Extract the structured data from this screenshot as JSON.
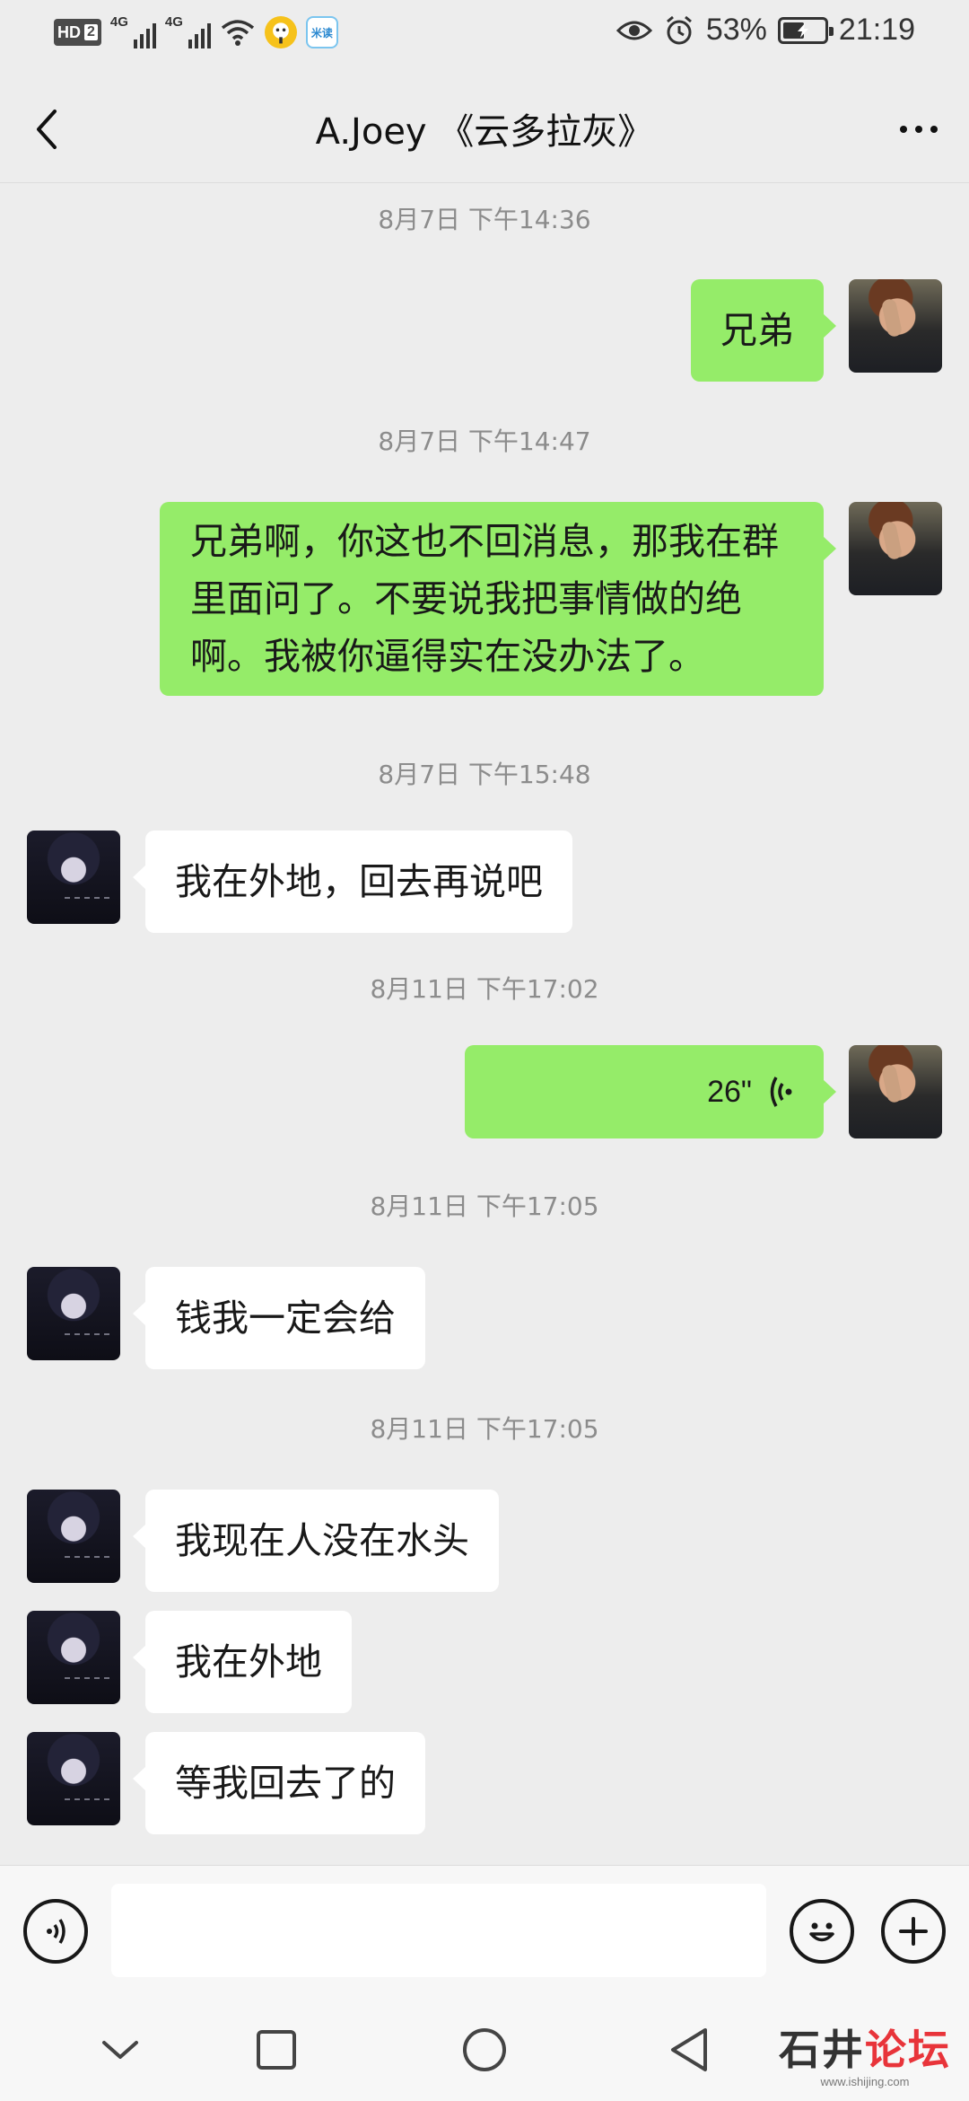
{
  "status_bar": {
    "hd_label": "HD",
    "sim_label": "2",
    "network_1": "4G",
    "network_2": "4G",
    "app_icon_2_label": "米读",
    "battery_percent": "53%",
    "battery_level": 0.53,
    "time": "21:19"
  },
  "header": {
    "title": "A.Joey 《云多拉灰》"
  },
  "messages": [
    {
      "kind": "timestamp",
      "text": "8月7日 下午14:36"
    },
    {
      "kind": "message",
      "sender": "me",
      "text": "兄弟"
    },
    {
      "kind": "timestamp",
      "text": "8月7日 下午14:47"
    },
    {
      "kind": "message",
      "sender": "me",
      "text": "兄弟啊，你这也不回消息，那我在群里面问了。不要说我把事情做的绝啊。我被你逼得实在没办法了。"
    },
    {
      "kind": "timestamp",
      "text": "8月7日 下午15:48"
    },
    {
      "kind": "message",
      "sender": "other",
      "text": "我在外地，回去再说吧"
    },
    {
      "kind": "timestamp",
      "text": "8月11日 下午17:02"
    },
    {
      "kind": "voice",
      "sender": "me",
      "duration": "26\""
    },
    {
      "kind": "timestamp",
      "text": "8月11日 下午17:05"
    },
    {
      "kind": "message",
      "sender": "other",
      "text": "钱我一定会给"
    },
    {
      "kind": "timestamp",
      "text": "8月11日 下午17:05"
    },
    {
      "kind": "message",
      "sender": "other",
      "text": "我现在人没在水头"
    },
    {
      "kind": "message",
      "sender": "other",
      "text": "我在外地"
    },
    {
      "kind": "message",
      "sender": "other",
      "text": "等我回去了的"
    }
  ],
  "input": {
    "value": "",
    "placeholder": ""
  },
  "watermark": {
    "part_1": "石井",
    "part_2": "论坛",
    "url": "www.ishijing.com"
  },
  "colors": {
    "background": "#ededed",
    "my_bubble": "#95ec69",
    "other_bubble": "#ffffff",
    "timestamp": "#8c8c8c",
    "watermark_accent": "#e8343a"
  }
}
